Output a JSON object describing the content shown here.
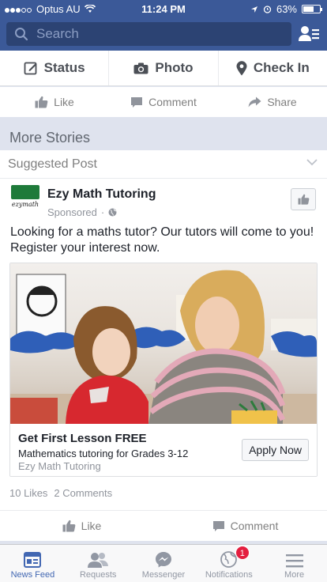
{
  "status_bar": {
    "carrier": "Optus AU",
    "time": "11:24 PM",
    "battery": "63%",
    "battery_level": 0.63
  },
  "search": {
    "placeholder": "Search"
  },
  "composer": {
    "status_label": "Status",
    "photo_label": "Photo",
    "checkin_label": "Check In"
  },
  "previous_post_actions": {
    "like_label": "Like",
    "comment_label": "Comment",
    "share_label": "Share"
  },
  "section": {
    "title": "More Stories"
  },
  "post": {
    "header_label": "Suggested Post",
    "logo_text": "ezymath",
    "author": "Ezy Math Tutoring",
    "meta": "Sponsored",
    "text": "Looking for a maths tutor? Our tutors will come to you! Register your interest now.",
    "ad": {
      "title": "Get First Lesson FREE",
      "description": "Mathematics tutoring for Grades 3-12",
      "source": "Ezy Math Tutoring",
      "cta_label": "Apply Now"
    },
    "likes": "10 Likes",
    "comments": "2 Comments",
    "like_label": "Like",
    "comment_label": "Comment"
  },
  "tabbar": {
    "tabs": [
      {
        "label": "News Feed",
        "icon": "news-feed-icon",
        "active": true
      },
      {
        "label": "Requests",
        "icon": "friend-requests-icon"
      },
      {
        "label": "Messenger",
        "icon": "messenger-icon"
      },
      {
        "label": "Notifications",
        "icon": "globe-icon",
        "badge": "1"
      },
      {
        "label": "More",
        "icon": "menu-icon"
      }
    ]
  },
  "colors": {
    "brand": "#3b5998",
    "active_tab": "#4267b2",
    "badge": "#e41e3f"
  }
}
